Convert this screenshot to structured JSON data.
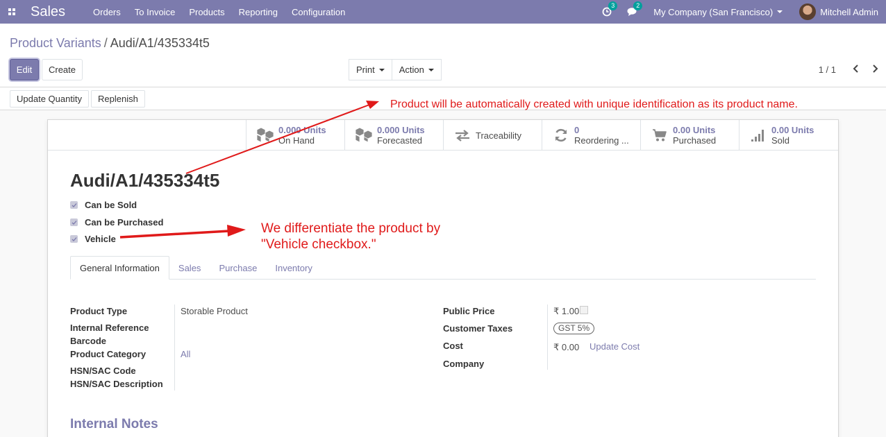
{
  "navbar": {
    "brand": "Sales",
    "menu": [
      "Orders",
      "To Invoice",
      "Products",
      "Reporting",
      "Configuration"
    ],
    "activity_count": "3",
    "message_count": "2",
    "company": "My Company (San Francisco)",
    "user": "Mitchell Admin",
    "color": "#7c7bad"
  },
  "control_panel": {
    "breadcrumb_parent": "Product Variants",
    "breadcrumb_current": "Audi/A1/435334t5",
    "edit_label": "Edit",
    "create_label": "Create",
    "print_label": "Print",
    "action_label": "Action",
    "pager": "1 / 1"
  },
  "statusbar": {
    "update_quantity_label": "Update Quantity",
    "replenish_label": "Replenish"
  },
  "annotations": {
    "name_note": "Product will be automatically created with unique identification as its product name.",
    "vehicle_note_line1": "We differentiate the product by",
    "vehicle_note_line2": "\"Vehicle checkbox.\"",
    "color": "#e01a1a"
  },
  "smart_buttons": [
    {
      "value": "0.000 Units",
      "label": "On Hand",
      "icon": "cubes-icon"
    },
    {
      "value": "0.000 Units",
      "label": "Forecasted",
      "icon": "cubes-icon"
    },
    {
      "value": "",
      "label": "Traceability",
      "icon": "exchange-icon"
    },
    {
      "value": "0",
      "label": "Reordering ...",
      "icon": "refresh-icon"
    },
    {
      "value": "0.00 Units",
      "label": "Purchased",
      "icon": "cart-icon"
    },
    {
      "value": "0.00 Units",
      "label": "Sold",
      "icon": "signal-icon"
    }
  ],
  "product": {
    "name": "Audi/A1/435334t5",
    "checkboxes": [
      {
        "label": "Can be Sold",
        "checked": true
      },
      {
        "label": "Can be Purchased",
        "checked": true
      },
      {
        "label": "Vehicle",
        "checked": true
      }
    ]
  },
  "tabs": [
    "General Information",
    "Sales",
    "Purchase",
    "Inventory"
  ],
  "fields_left": {
    "product_type_label": "Product Type",
    "product_type_value": "Storable Product",
    "internal_reference_label": "Internal Reference",
    "barcode_label": "Barcode",
    "product_category_label": "Product Category",
    "product_category_value": "All",
    "hsn_code_label": "HSN/SAC Code",
    "hsn_desc_label": "HSN/SAC Description"
  },
  "fields_right": {
    "public_price_label": "Public Price",
    "public_price_value": "₹ 1.00",
    "customer_taxes_label": "Customer Taxes",
    "customer_taxes_value": "GST 5%",
    "cost_label": "Cost",
    "cost_value": "₹ 0.00",
    "update_cost_label": "Update Cost",
    "company_label": "Company"
  },
  "internal_notes_title": "Internal Notes"
}
